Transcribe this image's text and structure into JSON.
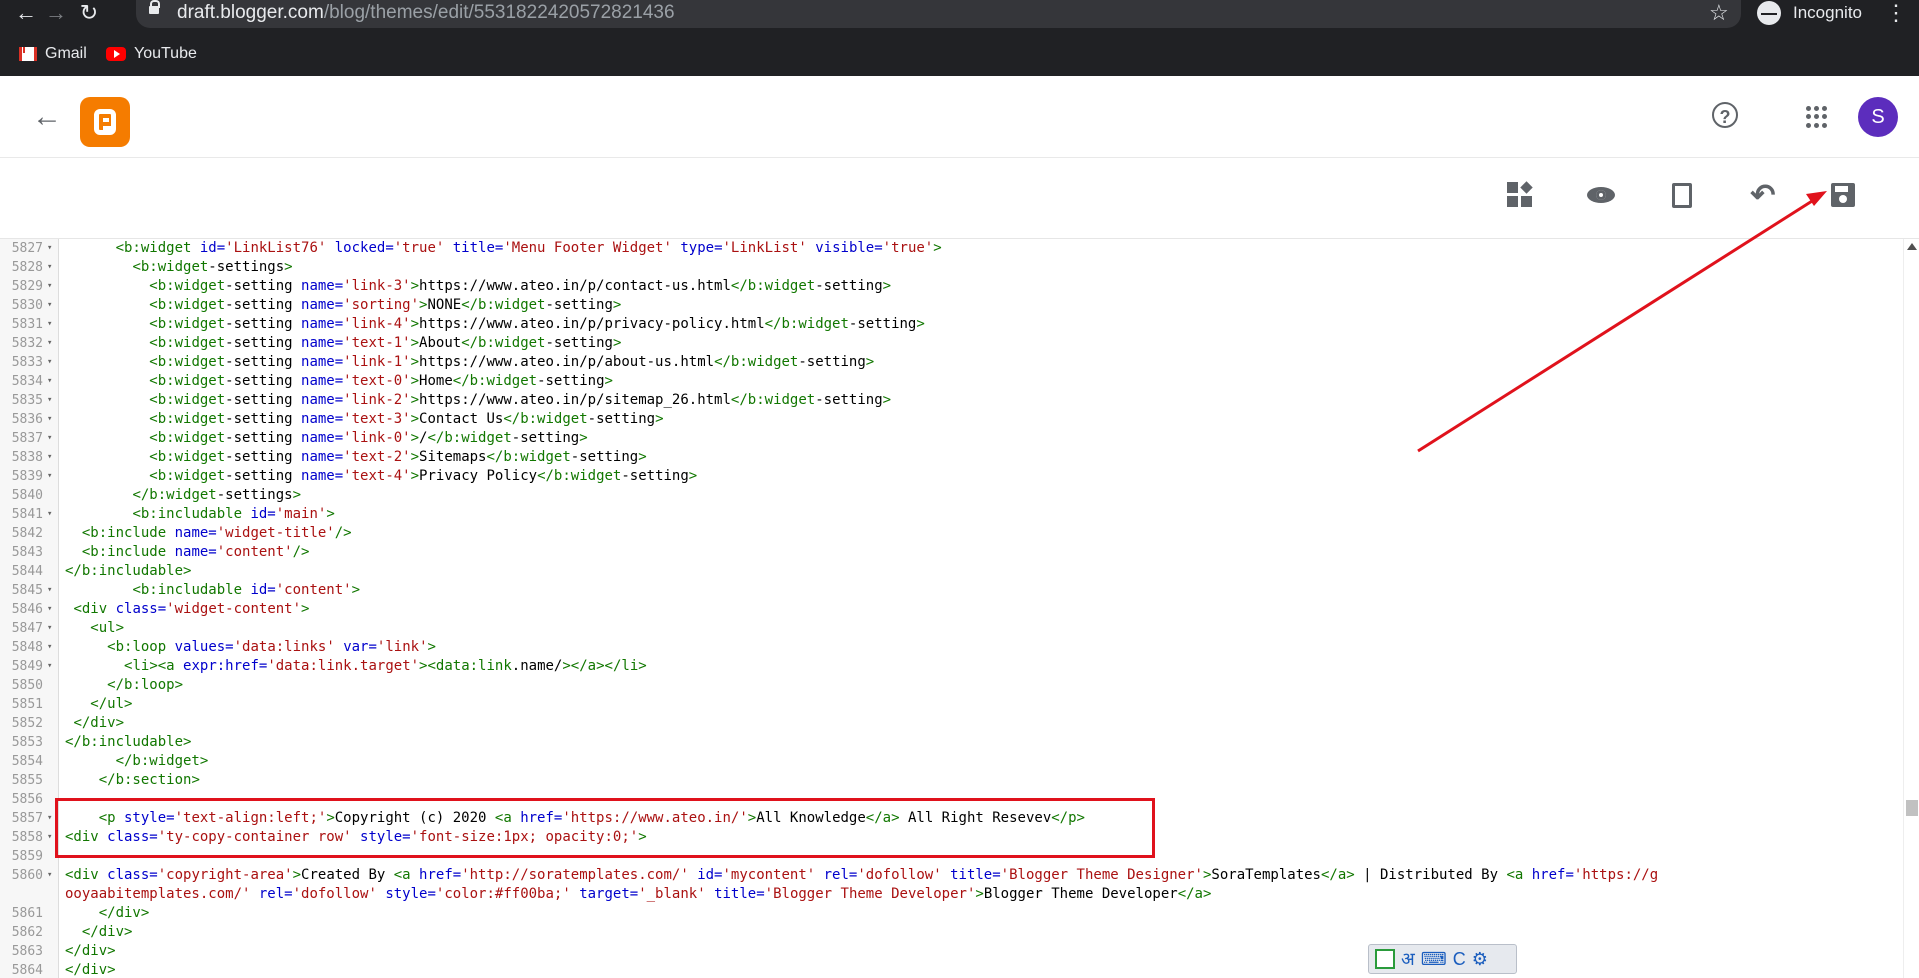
{
  "browser": {
    "url_host": "draft.blogger.com",
    "url_path": "/blog/themes/edit/5531822420572821436",
    "profile_label": "Incognito",
    "bookmarks": [
      "Gmail",
      "YouTube"
    ]
  },
  "header": {
    "app": "Blogger",
    "avatar_letter": "S"
  },
  "toolbar": {
    "tools": [
      "layout",
      "preview",
      "revert",
      "undo",
      "save"
    ]
  },
  "editor": {
    "lines": [
      {
        "n": "5827",
        "fold": true,
        "code": "      <b:widget id='LinkList76' locked='true' title='Menu Footer Widget' type='LinkList' visible='true'>"
      },
      {
        "n": "5828",
        "fold": true,
        "code": "        <b:widget-settings>"
      },
      {
        "n": "5829",
        "fold": true,
        "code": "          <b:widget-setting name='link-3'>https://www.ateo.in/p/contact-us.html</b:widget-setting>"
      },
      {
        "n": "5830",
        "fold": true,
        "code": "          <b:widget-setting name='sorting'>NONE</b:widget-setting>"
      },
      {
        "n": "5831",
        "fold": true,
        "code": "          <b:widget-setting name='link-4'>https://www.ateo.in/p/privacy-policy.html</b:widget-setting>"
      },
      {
        "n": "5832",
        "fold": true,
        "code": "          <b:widget-setting name='text-1'>About</b:widget-setting>"
      },
      {
        "n": "5833",
        "fold": true,
        "code": "          <b:widget-setting name='link-1'>https://www.ateo.in/p/about-us.html</b:widget-setting>"
      },
      {
        "n": "5834",
        "fold": true,
        "code": "          <b:widget-setting name='text-0'>Home</b:widget-setting>"
      },
      {
        "n": "5835",
        "fold": true,
        "code": "          <b:widget-setting name='link-2'>https://www.ateo.in/p/sitemap_26.html</b:widget-setting>"
      },
      {
        "n": "5836",
        "fold": true,
        "code": "          <b:widget-setting name='text-3'>Contact Us</b:widget-setting>"
      },
      {
        "n": "5837",
        "fold": true,
        "code": "          <b:widget-setting name='link-0'>/</b:widget-setting>"
      },
      {
        "n": "5838",
        "fold": true,
        "code": "          <b:widget-setting name='text-2'>Sitemaps</b:widget-setting>"
      },
      {
        "n": "5839",
        "fold": true,
        "code": "          <b:widget-setting name='text-4'>Privacy Policy</b:widget-setting>"
      },
      {
        "n": "5840",
        "fold": false,
        "code": "        </b:widget-settings>"
      },
      {
        "n": "5841",
        "fold": true,
        "code": "        <b:includable id='main'>"
      },
      {
        "n": "5842",
        "fold": false,
        "code": "  <b:include name='widget-title'/>"
      },
      {
        "n": "5843",
        "fold": false,
        "code": "  <b:include name='content'/>"
      },
      {
        "n": "5844",
        "fold": false,
        "code": "</b:includable>"
      },
      {
        "n": "5845",
        "fold": true,
        "code": "        <b:includable id='content'>"
      },
      {
        "n": "5846",
        "fold": true,
        "code": " <div class='widget-content'>"
      },
      {
        "n": "5847",
        "fold": true,
        "code": "   <ul>"
      },
      {
        "n": "5848",
        "fold": true,
        "code": "     <b:loop values='data:links' var='link'>"
      },
      {
        "n": "5849",
        "fold": true,
        "code": "       <li><a expr:href='data:link.target'><data:link.name/></a></li>"
      },
      {
        "n": "5850",
        "fold": false,
        "code": "     </b:loop>"
      },
      {
        "n": "5851",
        "fold": false,
        "code": "   </ul>"
      },
      {
        "n": "5852",
        "fold": false,
        "code": " </div>"
      },
      {
        "n": "5853",
        "fold": false,
        "code": "</b:includable>"
      },
      {
        "n": "5854",
        "fold": false,
        "code": "      </b:widget>"
      },
      {
        "n": "5855",
        "fold": false,
        "code": "    </b:section>"
      },
      {
        "n": "5856",
        "fold": false,
        "code": ""
      },
      {
        "n": "5857",
        "fold": true,
        "code": "    <p style='text-align:left;'>Copyright (c) 2020 <a href='https://www.ateo.in/'>All Knowledge</a> All Right Resevev</p>"
      },
      {
        "n": "5858",
        "fold": true,
        "code": "<div class='ty-copy-container row' style='font-size:1px; opacity:0;'>"
      },
      {
        "n": "5859",
        "fold": false,
        "code": ""
      },
      {
        "n": "5860",
        "fold": true,
        "tall": true,
        "code": "    <div class='copyright-area'>Created By <a href='http://soratemplates.com/' id='mycontent' rel='dofollow' title='Blogger Theme Designer'>SoraTemplates</a>  | Distributed By <a href='https://gooyaabitemplates.com/' rel='dofollow' style='color:#ff00ba;' target='_blank' title='Blogger Theme Developer'>Blogger Theme Developer</a>"
      },
      {
        "n": "5861",
        "fold": false,
        "code": "    </div>"
      },
      {
        "n": "5862",
        "fold": false,
        "code": "  </div>"
      },
      {
        "n": "5863",
        "fold": false,
        "code": "</div>"
      },
      {
        "n": "5864",
        "fold": false,
        "code": "</div>"
      }
    ]
  },
  "ime": {
    "script_glyph": "अ",
    "label_c": "C"
  }
}
